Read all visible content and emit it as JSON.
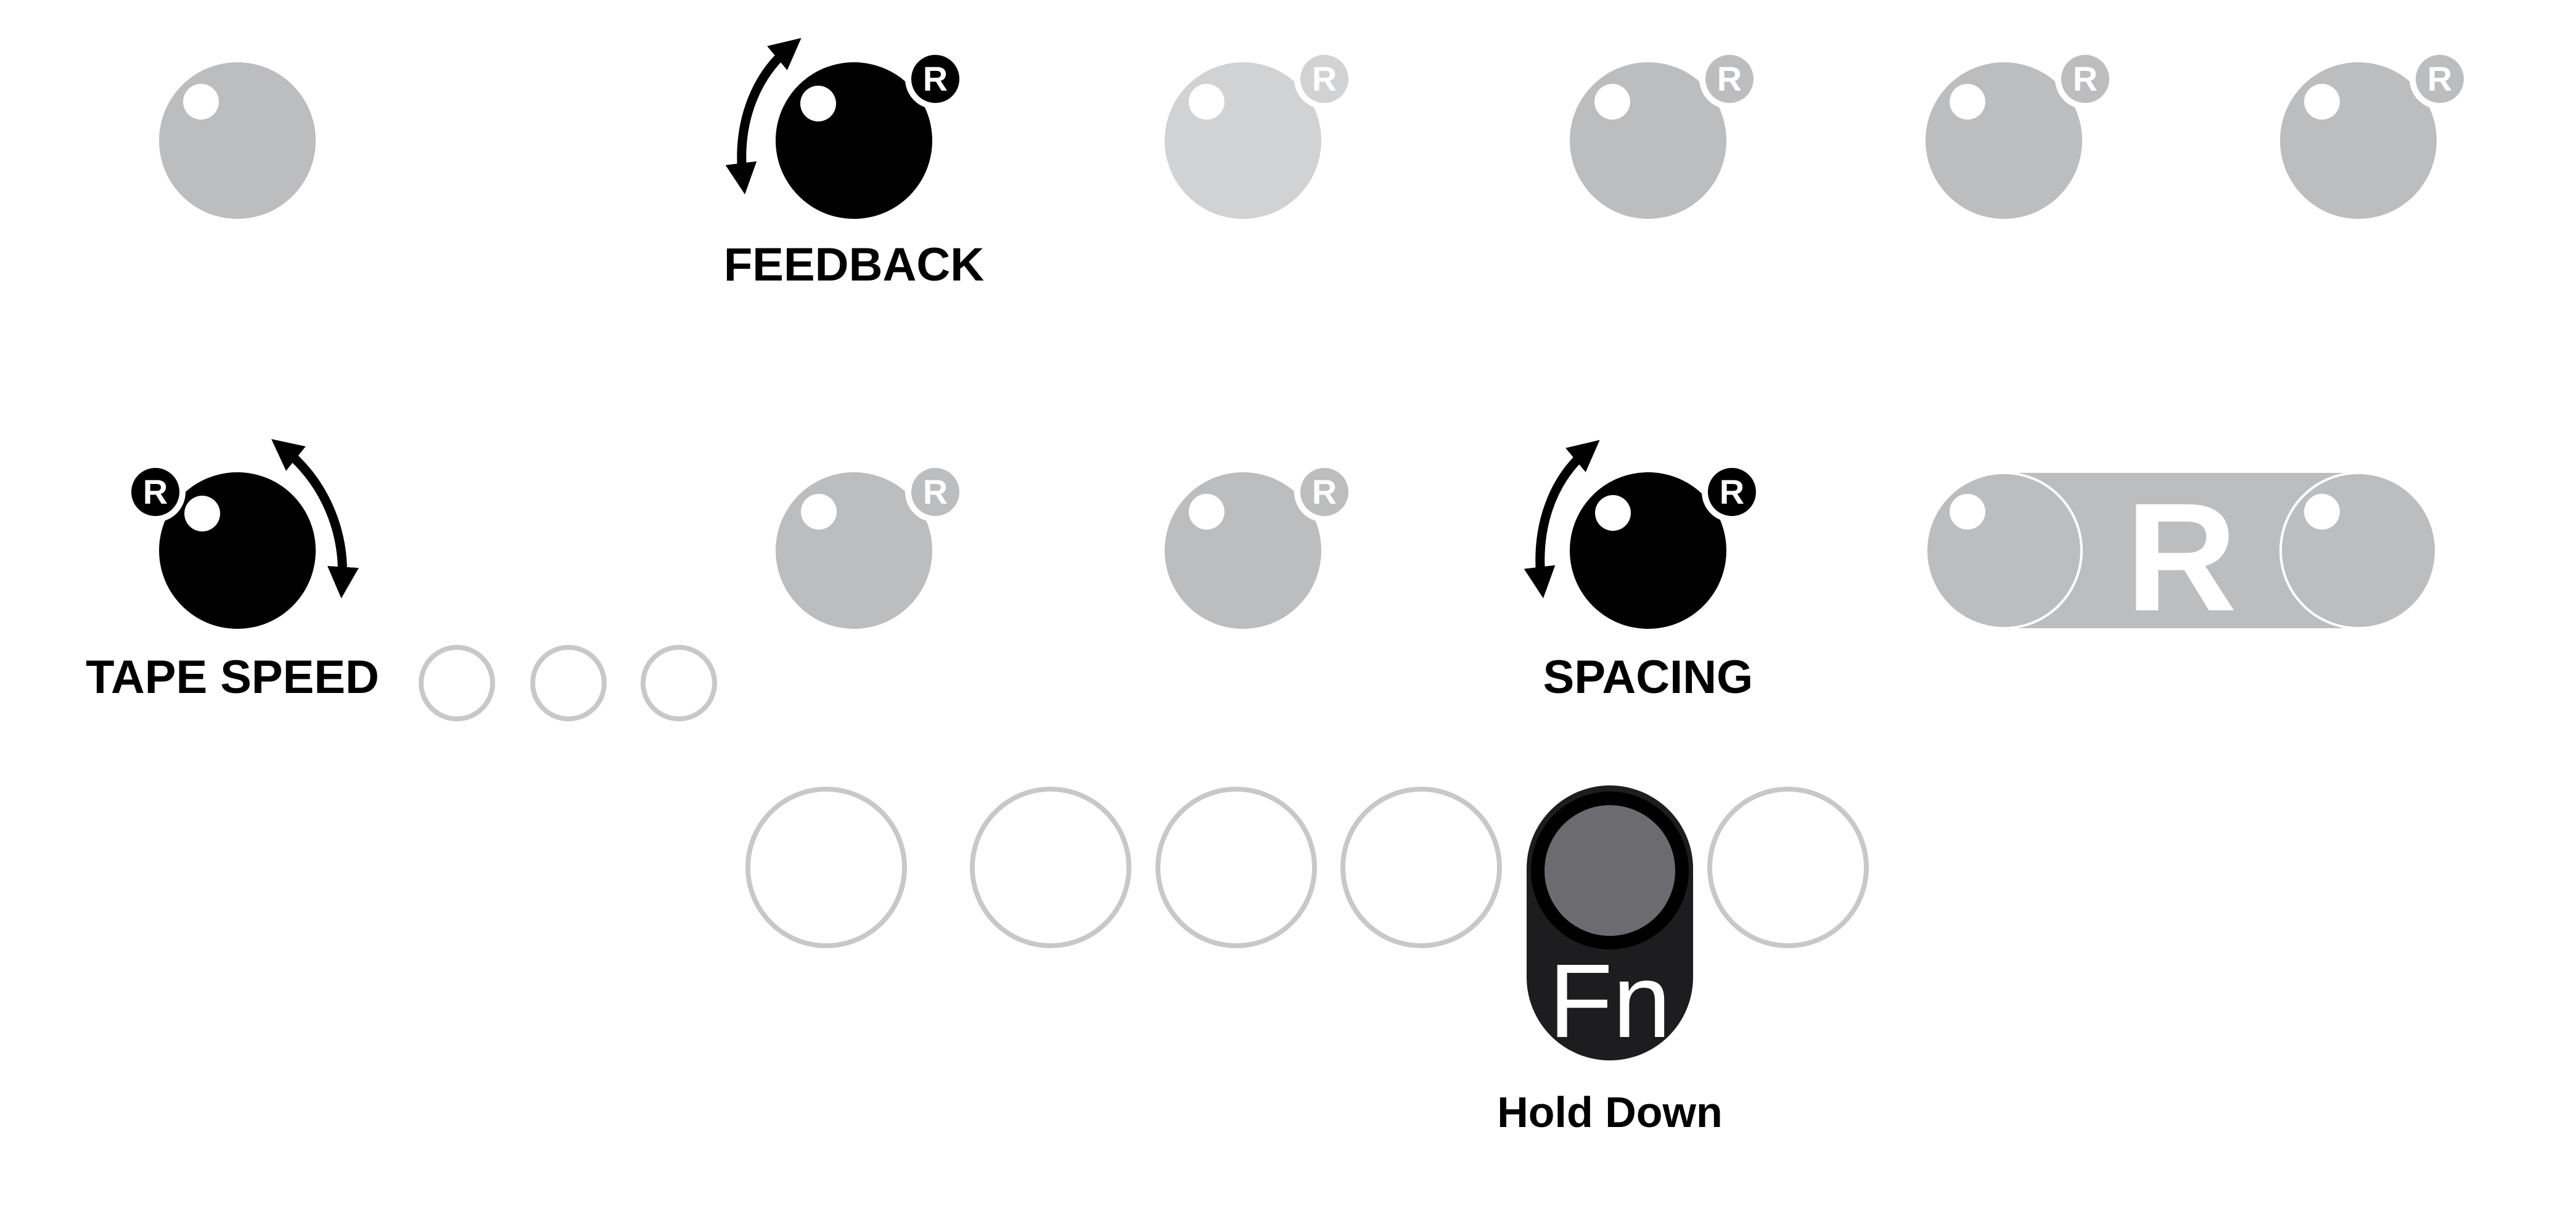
{
  "colors": {
    "active_knob": "#000000",
    "inactive_knob": "#bcbdbf",
    "dim_knob": "#d1d2d4",
    "outline": "#c8c8c8",
    "fn_body": "#1d1d1f",
    "fn_cap": "#6c6c70",
    "highlight": "#ffffff"
  },
  "labels": {
    "feedback": "FEEDBACK",
    "tape_speed": "TAPE SPEED",
    "spacing": "SPACING",
    "hold_down": "Hold Down"
  },
  "badges": {
    "reset": "R",
    "switch": "R",
    "fn": "Fn"
  },
  "icons": {
    "rotate_ccw": "rotate-ccw-arrow-icon",
    "rotate_cw": "rotate-cw-arrow-icon",
    "reset_badge": "reset-badge-icon"
  }
}
